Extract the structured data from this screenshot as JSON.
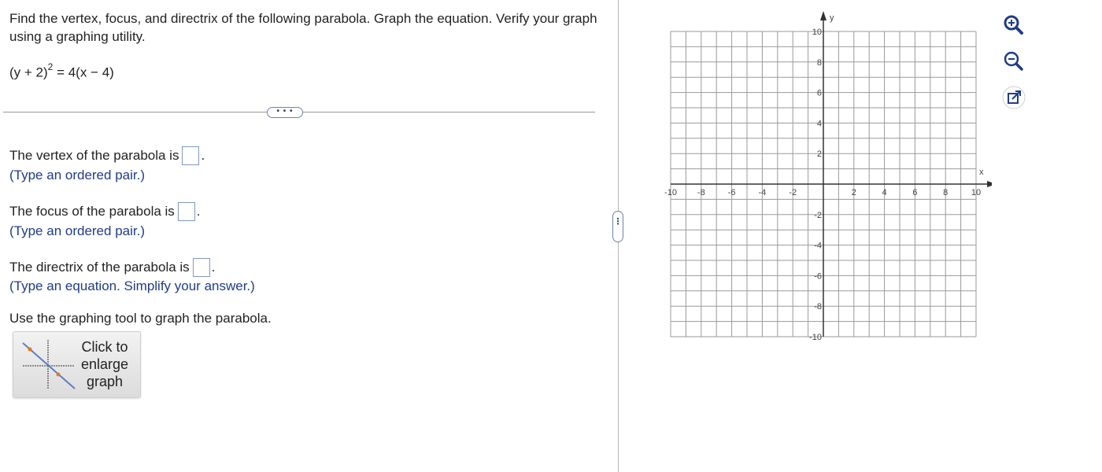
{
  "question": {
    "text": "Find the vertex, focus, and directrix of the following parabola. Graph the equation. Verify your graph using a graphing utility.",
    "equation_base": "(y + 2)",
    "equation_exponent": "2",
    "equation_rest": " = 4(x − 4)"
  },
  "divider": {
    "more_label": "• • •"
  },
  "answers": [
    {
      "prefix": "The vertex of the parabola is",
      "suffix": ".",
      "hint": "(Type an ordered pair.)",
      "value": ""
    },
    {
      "prefix": "The focus of the parabola is",
      "suffix": ".",
      "hint": "(Type an ordered pair.)",
      "value": ""
    },
    {
      "prefix": "The directrix of the parabola is",
      "suffix": ".",
      "hint": "(Type an equation. Simplify your answer.)",
      "value": ""
    }
  ],
  "graph_tool": {
    "instruction": "Use the graphing tool to graph the parabola.",
    "enlarge_label": "Click to enlarge graph"
  },
  "splitter": {
    "label": "⋮"
  },
  "graph": {
    "x_label": "x",
    "y_label": "y",
    "x_min": -10,
    "x_max": 10,
    "y_min": -10,
    "y_max": 10,
    "tick_labels_x": [
      "-10",
      "-8",
      "-6",
      "-4",
      "-2",
      "2",
      "4",
      "6",
      "8",
      "10"
    ],
    "tick_labels_y": [
      "10",
      "8",
      "6",
      "4",
      "2",
      "-2",
      "-4",
      "-6",
      "-8",
      "-10"
    ],
    "grid": true,
    "colors": {
      "grid": "#9a9a9a",
      "axis": "#333333"
    }
  },
  "tools": [
    {
      "name": "zoom-in-icon"
    },
    {
      "name": "zoom-out-icon"
    },
    {
      "name": "pop-out-icon"
    }
  ]
}
